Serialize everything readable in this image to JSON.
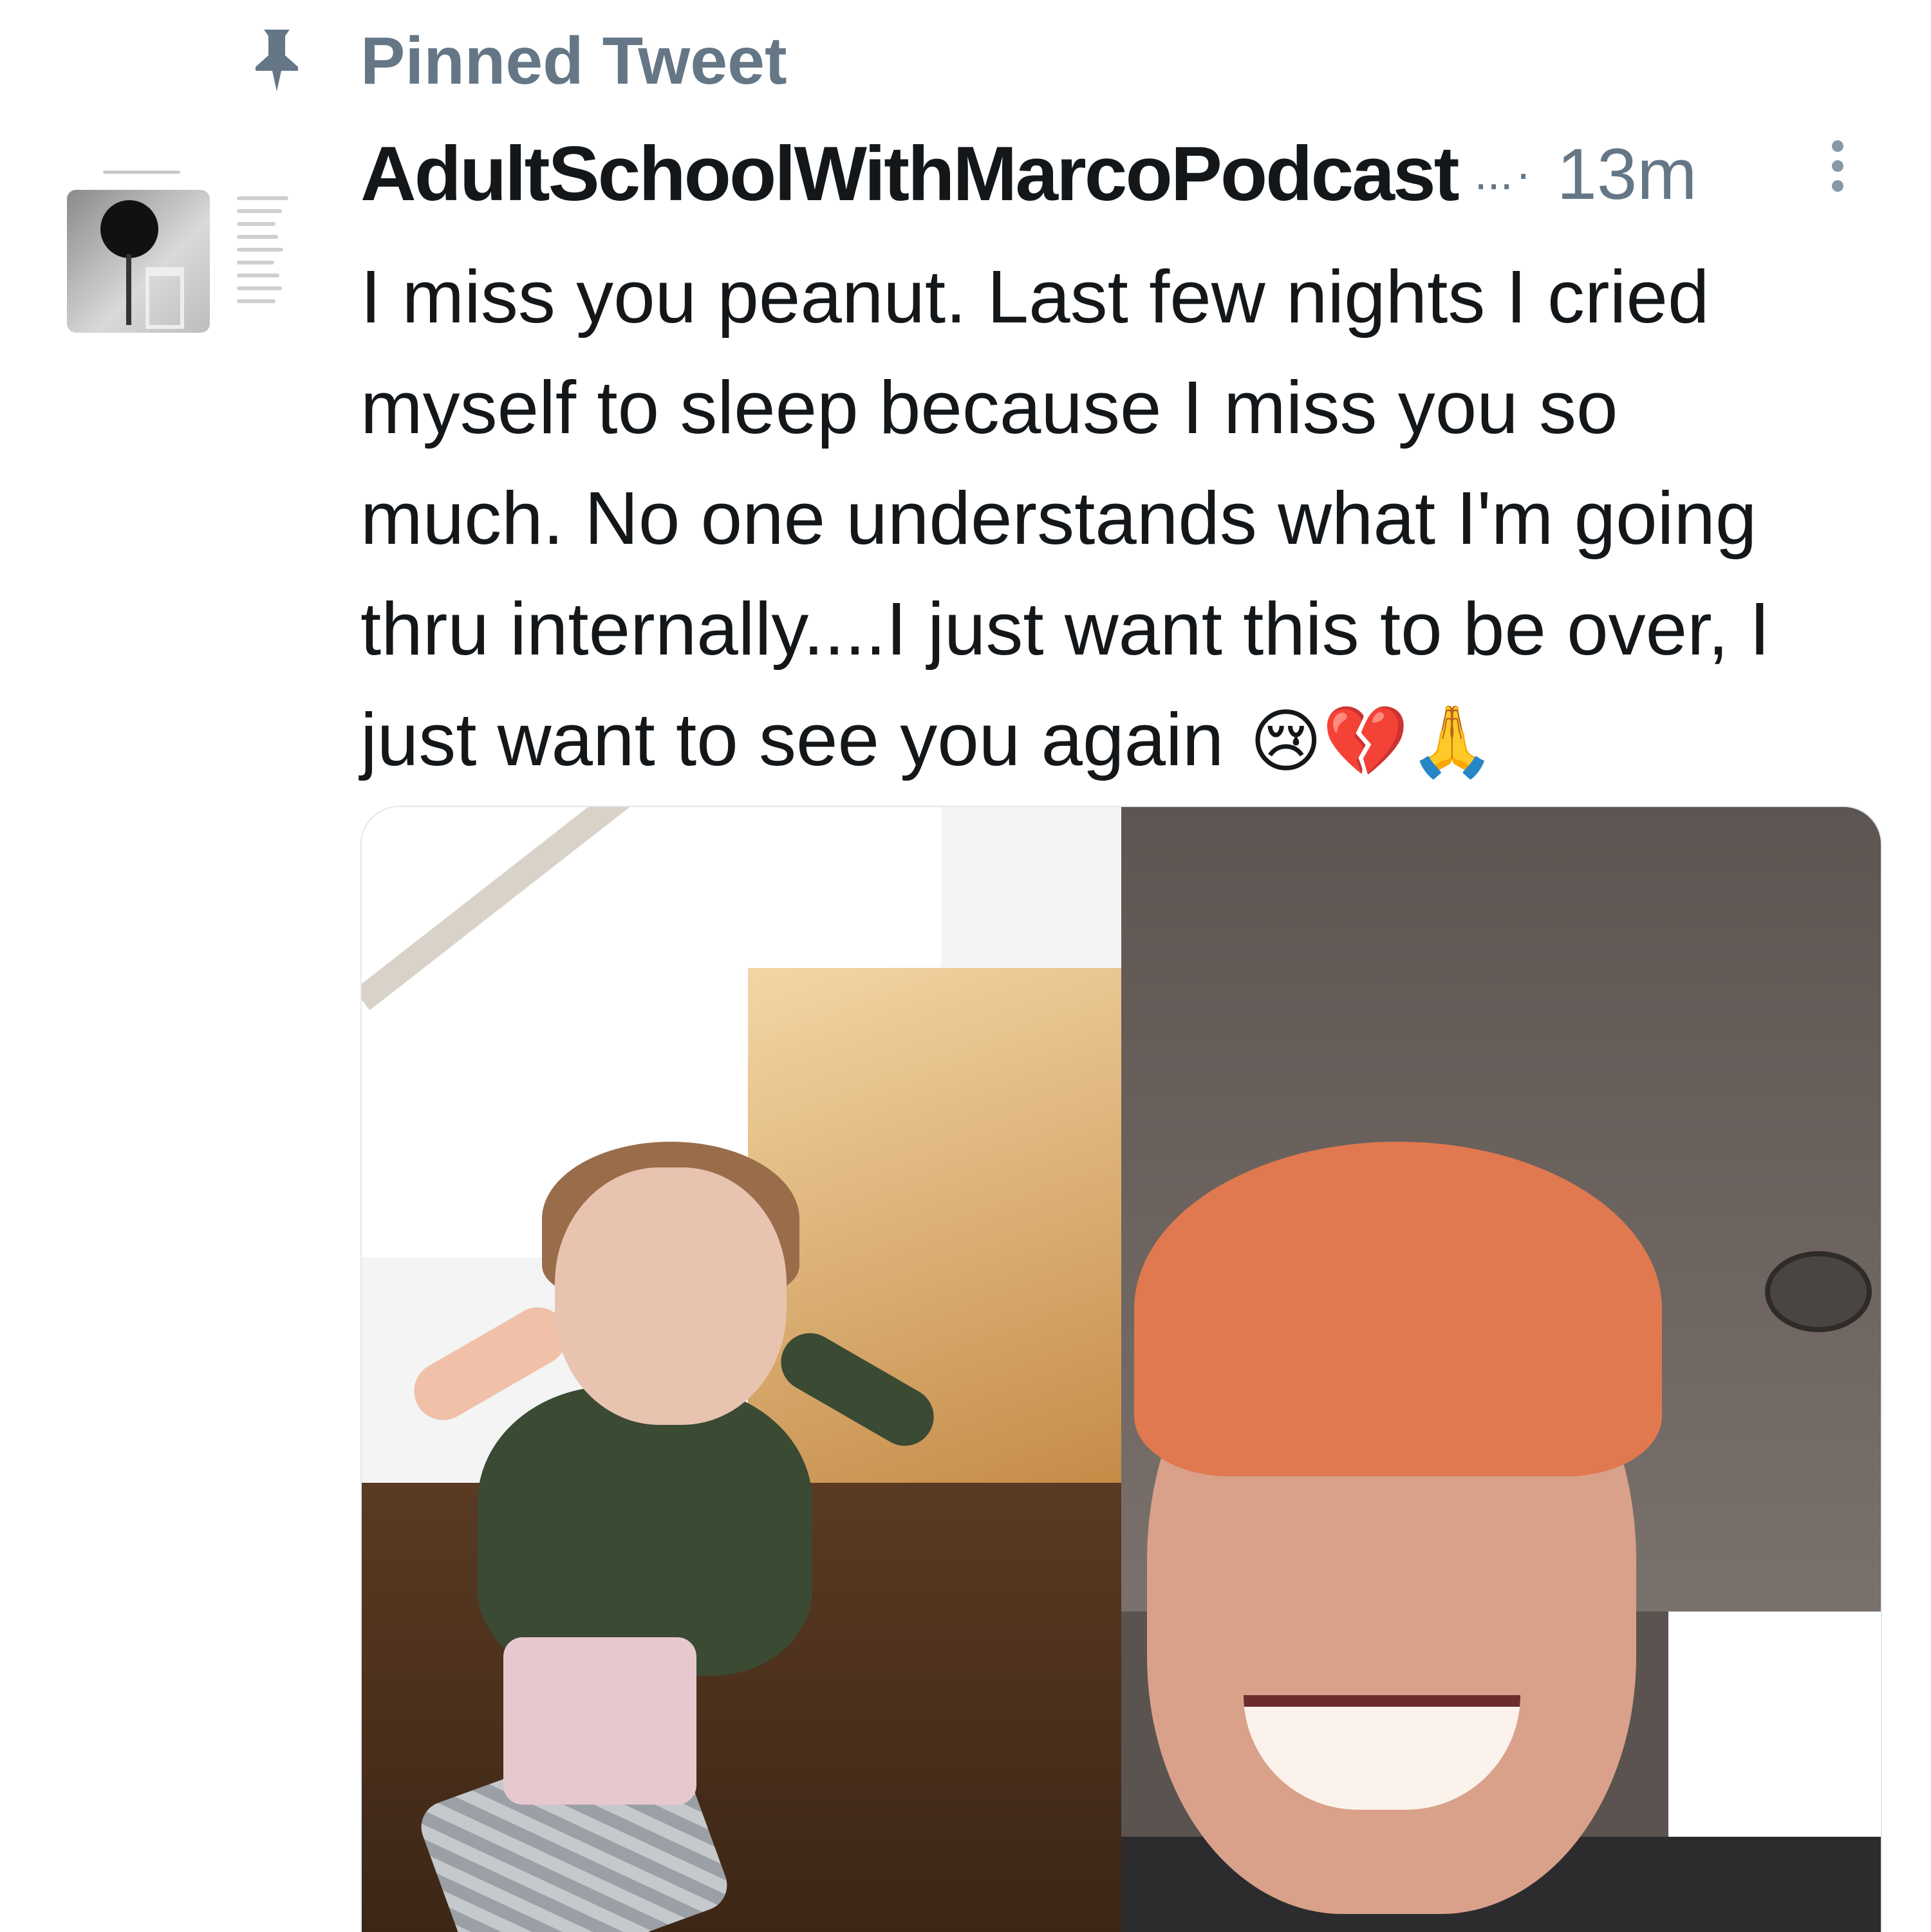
{
  "pinned": {
    "label": "Pinned Tweet",
    "icon": "pin-icon"
  },
  "tweet": {
    "author": "AdultSchoolWithMarcoPodcast",
    "truncation": "...",
    "separator": "·",
    "time": "13m",
    "body": "I miss you peanut.  Last few nights I cried\nmyself to sleep because I miss you so\nmuch. No one understands what I'm going\nthru internally....I just want this to be over, I\njust want to see you again",
    "emojis": "😢💔🙏"
  },
  "colors": {
    "muted": "#657786",
    "text": "#14171a",
    "border": "#e1e8ed"
  }
}
